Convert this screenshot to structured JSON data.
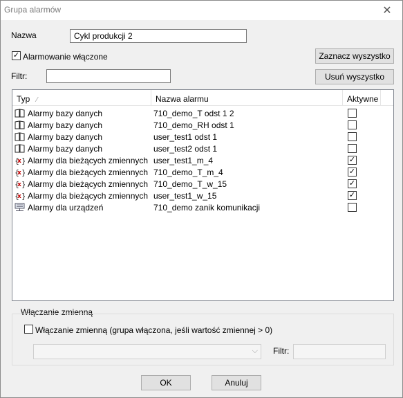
{
  "window": {
    "title": "Grupa alarmów"
  },
  "form": {
    "name_label": "Nazwa",
    "name_value": "Cykl produkcji 2",
    "alarming_label": "Alarmowanie włączone",
    "filter_label": "Filtr:",
    "filter_value": "",
    "select_all_label": "Zaznacz wyszystko",
    "remove_all_label": "Usuń wyszystko"
  },
  "table": {
    "columns": [
      "Typ",
      "Nazwa alarmu",
      "Aktywne"
    ],
    "sort_indicator": "⁄",
    "rows": [
      {
        "icon": "book-icon",
        "type": "Alarmy bazy danych",
        "name": "710_demo_T odst 1 2",
        "active": false
      },
      {
        "icon": "book-icon",
        "type": "Alarmy bazy danych",
        "name": "710_demo_RH odst 1",
        "active": false
      },
      {
        "icon": "book-icon",
        "type": "Alarmy bazy danych",
        "name": "user_test1 odst 1",
        "active": false
      },
      {
        "icon": "book-icon",
        "type": "Alarmy bazy danych",
        "name": "user_test2 odst 1",
        "active": false
      },
      {
        "icon": "variable-icon",
        "type": "Alarmy dla bieżących zmiennych",
        "name": "user_test1_m_4",
        "active": true
      },
      {
        "icon": "variable-icon",
        "type": "Alarmy dla bieżących zmiennych",
        "name": "710_demo_T_m_4",
        "active": true
      },
      {
        "icon": "variable-icon",
        "type": "Alarmy dla bieżących zmiennych",
        "name": "710_demo_T_w_15",
        "active": true
      },
      {
        "icon": "variable-icon",
        "type": "Alarmy dla bieżących zmiennych",
        "name": "user_test1_w_15",
        "active": true
      },
      {
        "icon": "device-icon",
        "type": "Alarmy dla urządzeń",
        "name": "710_demo zanik komunikacji",
        "active": false
      }
    ]
  },
  "enable_group": {
    "title": "Włączanie zmienną",
    "checkbox_label": "Włączanie zmienną (grupa włączona, jeśli wartość zmiennej > 0)",
    "filter_label": "Filtr:",
    "combo_value": "",
    "filter_value": ""
  },
  "buttons": {
    "ok": "OK",
    "cancel": "Anuluj"
  }
}
